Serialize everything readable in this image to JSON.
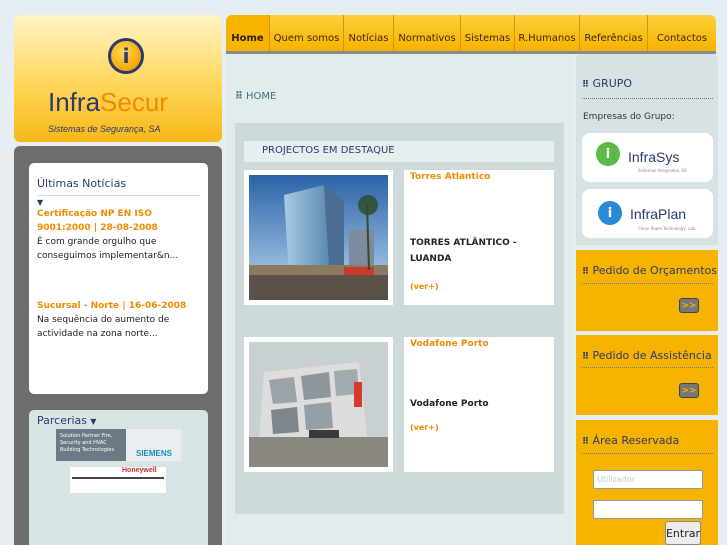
{
  "logo": {
    "name_part1": "Infra",
    "name_part2": "Secur",
    "tagline": "Sistemas de Segurança, SA"
  },
  "nav": {
    "tabs": [
      {
        "label": "Home",
        "active": true
      },
      {
        "label": "Quem somos"
      },
      {
        "label": "Notícias"
      },
      {
        "label": "Normativos"
      },
      {
        "label": "Sistemas"
      },
      {
        "label": "R.Humanos"
      },
      {
        "label": "Referências"
      },
      {
        "label": "Contactos"
      }
    ]
  },
  "breadcrumb": "HOME",
  "news": {
    "title": "Últimas Notícias",
    "items": [
      {
        "headline": "Certificação NP EN ISO 9001:2000 | 28-08-2008",
        "text": "É com grande orgulho que conseguimos implementar&n..."
      },
      {
        "headline": "Sucursal - Norte | 16-06-2008",
        "text": "Na sequência do aumento de actividade na zona norte..."
      }
    ]
  },
  "partners": {
    "title": "Parcerias",
    "siemens_text": "Solution Partner Fire, Security and HVAC Building Technologies",
    "siemens_name": "SIEMENS",
    "honeywell_name": "Honeywell"
  },
  "featured": {
    "title": "PROJECTOS EM DESTAQUE",
    "projects": [
      {
        "name": "Torres Atlantico",
        "desc": "TORRES ATLÂNTICO - LUANDA",
        "more": "(ver+)"
      },
      {
        "name": "Vodafone Porto",
        "desc": "Vodafone Porto",
        "more": "(ver+)"
      }
    ]
  },
  "sidebar": {
    "grupo_title": "GRUPO",
    "empresas_label": "Empresas do Grupo:",
    "companies": [
      {
        "name": "InfraSys",
        "sub": "Sistemas Integrados, SA"
      },
      {
        "name": "InfraPlan",
        "sub": "Clean Room Technology, Lda."
      }
    ],
    "orcamentos_title": "Pedido de Orçamentos",
    "assistencia_title": "Pedido de Assistência",
    "area_title": "Área Reservada",
    "user_placeholder": "Utilizador",
    "go_label": ">>",
    "login_label": "Entrar"
  },
  "colors": {
    "accent": "#f6b300",
    "brand_blue": "#2a3a6e",
    "highlight_orange": "#f08a00"
  }
}
